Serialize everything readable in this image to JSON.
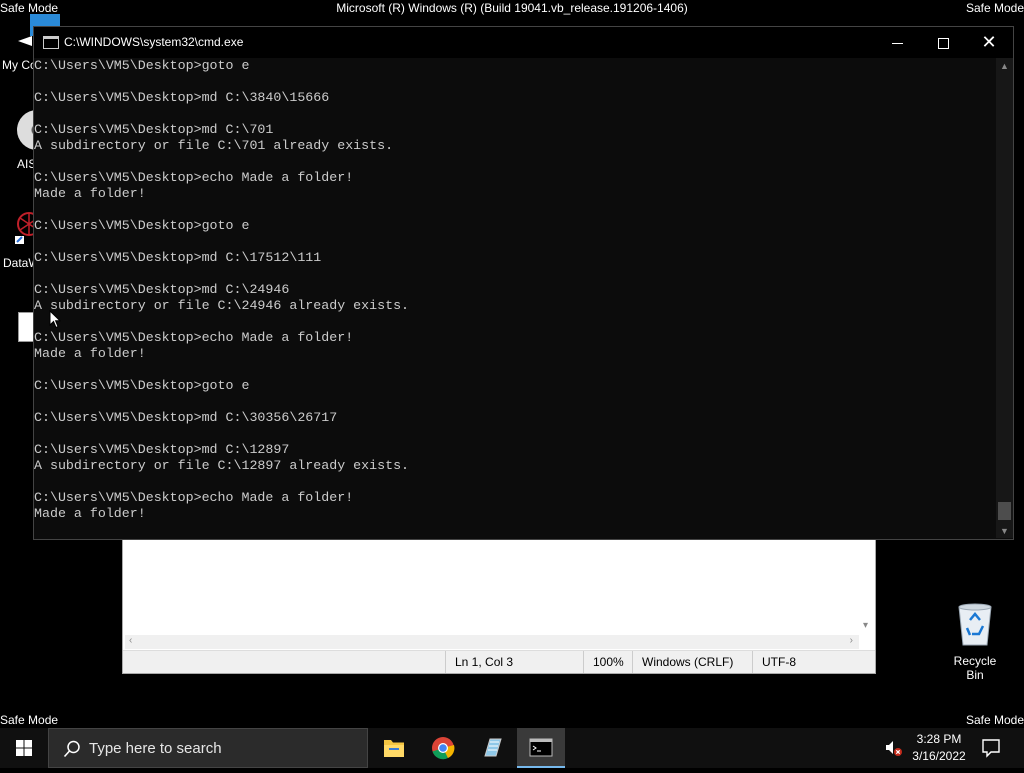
{
  "safe_mode_label": "Safe Mode",
  "build_text": "Microsoft (R) Windows (R) (Build 19041.vb_release.191206-1406)",
  "desktop_icons": {
    "my_computer": "My Co",
    "ais": "AIS",
    "dataw": "DataW"
  },
  "cmd": {
    "title": "C:\\WINDOWS\\system32\\cmd.exe",
    "lines": [
      "C:\\Users\\VM5\\Desktop>goto e",
      "",
      "C:\\Users\\VM5\\Desktop>md C:\\3840\\15666",
      "",
      "C:\\Users\\VM5\\Desktop>md C:\\701",
      "A subdirectory or file C:\\701 already exists.",
      "",
      "C:\\Users\\VM5\\Desktop>echo Made a folder!",
      "Made a folder!",
      "",
      "C:\\Users\\VM5\\Desktop>goto e",
      "",
      "C:\\Users\\VM5\\Desktop>md C:\\17512\\111",
      "",
      "C:\\Users\\VM5\\Desktop>md C:\\24946",
      "A subdirectory or file C:\\24946 already exists.",
      "",
      "C:\\Users\\VM5\\Desktop>echo Made a folder!",
      "Made a folder!",
      "",
      "C:\\Users\\VM5\\Desktop>goto e",
      "",
      "C:\\Users\\VM5\\Desktop>md C:\\30356\\26717",
      "",
      "C:\\Users\\VM5\\Desktop>md C:\\12897",
      "A subdirectory or file C:\\12897 already exists.",
      "",
      "C:\\Users\\VM5\\Desktop>echo Made a folder!",
      "Made a folder!"
    ]
  },
  "notepad_status": {
    "position": "Ln 1, Col 3",
    "zoom": "100%",
    "line_endings": "Windows (CRLF)",
    "encoding": "UTF-8"
  },
  "recycle_bin_label": "Recycle Bin",
  "taskbar": {
    "search_placeholder": "Type here to search",
    "time": "3:28 PM",
    "date": "3/16/2022",
    "apps": [
      "file-explorer",
      "chrome",
      "notepad",
      "command-prompt"
    ]
  },
  "colors": {
    "cmd_bg": "#0c0c0c",
    "cmd_text": "#cccccc",
    "taskbar_bg": "#101010",
    "accent": "#76b9ed"
  }
}
